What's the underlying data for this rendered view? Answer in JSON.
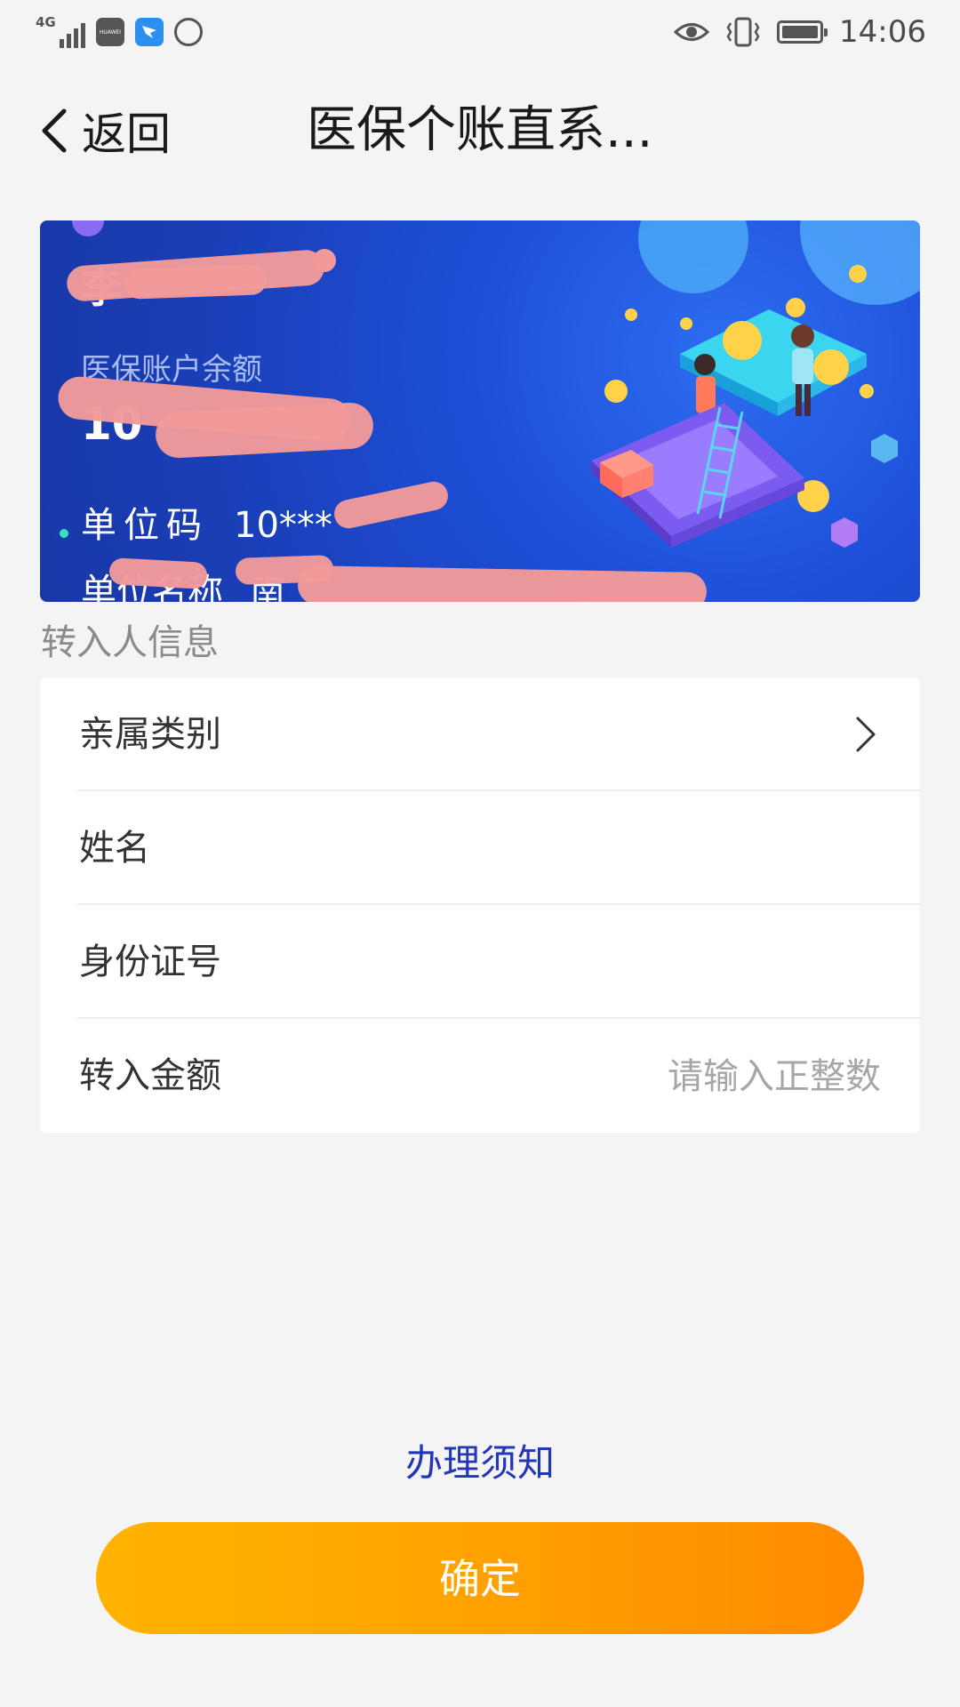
{
  "status_bar": {
    "network": "4G",
    "huawei_label": "HUAWEI",
    "time": "14:06"
  },
  "header": {
    "back_label": "返回",
    "title": "医保个账直系..."
  },
  "card": {
    "name": "李",
    "balance_label": "医保账户余额",
    "balance_value": "10",
    "unit_code_label": "单位码",
    "unit_code_value": "10***",
    "unit_name_label": "单位名称",
    "unit_name_value": "南"
  },
  "section": {
    "title": "转入人信息"
  },
  "form": {
    "relation_label": "亲属类别",
    "name_label": "姓名",
    "id_label": "身份证号",
    "amount_label": "转入金额",
    "amount_placeholder": "请输入正整数"
  },
  "footer": {
    "notice_link": "办理须知",
    "confirm_button": "确定"
  },
  "colors": {
    "card_blue": "#1d4fd8",
    "button_orange": "#ffa000",
    "link_blue": "#2236b8",
    "redaction_pink": "#f29a9a"
  }
}
